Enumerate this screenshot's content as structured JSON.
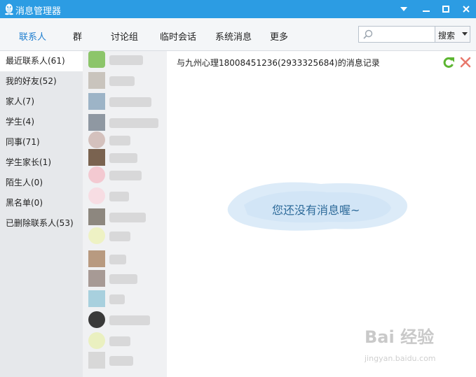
{
  "window": {
    "title": "消息管理器"
  },
  "nav": {
    "tabs": [
      {
        "label": "联系人"
      },
      {
        "label": "群"
      },
      {
        "label": "讨论组"
      },
      {
        "label": "临时会话"
      },
      {
        "label": "系统消息"
      },
      {
        "label": "更多"
      }
    ],
    "active_tab": "联系人"
  },
  "search": {
    "placeholder": "",
    "button_label": "搜索"
  },
  "sidebar": {
    "categories": [
      {
        "label": "最近联系人(61)"
      },
      {
        "label": "我的好友(52)"
      },
      {
        "label": "家人(7)"
      },
      {
        "label": "学生(4)"
      },
      {
        "label": "同事(71)"
      },
      {
        "label": "学生家长(1)"
      },
      {
        "label": "陌生人(0)"
      },
      {
        "label": "黑名单(0)"
      },
      {
        "label": "已删除联系人(53)"
      }
    ]
  },
  "main": {
    "history_title": "与九州心理18008451236(2933325684)的消息记录",
    "empty_message": "您还没有消息喔~"
  },
  "watermark": {
    "main": "Bai 经验",
    "sub": "jingyan.baidu.com"
  },
  "colors": {
    "titlebar": "#2c9ce3",
    "active_tab": "#1f7fd0",
    "sidebar_bg": "#e6e8eb",
    "empty_text": "#2e6b9a",
    "refresh_icon": "#5cb531",
    "delete_icon": "#e8786c"
  }
}
